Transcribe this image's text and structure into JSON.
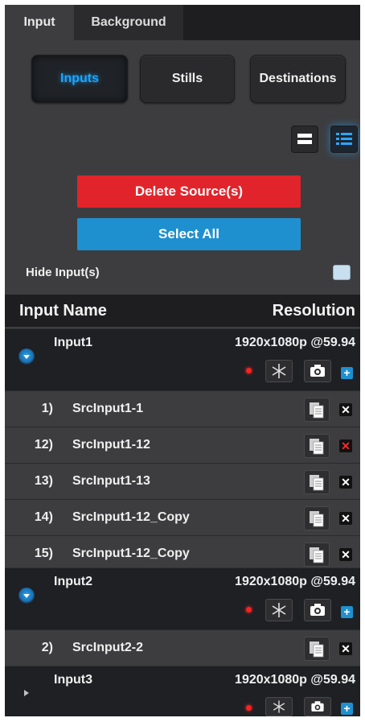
{
  "tabs": [
    {
      "label": "Input",
      "active": true
    },
    {
      "label": "Background",
      "active": false
    }
  ],
  "modes": {
    "inputs": "Inputs",
    "stills": "Stills",
    "destinations": "Destinations",
    "active": "inputs"
  },
  "view_toggle": {
    "single_icon": "single-view-icon",
    "list_icon": "list-view-icon",
    "active": "list"
  },
  "actions": {
    "delete_label": "Delete Source(s)",
    "select_all_label": "Select All"
  },
  "hide_inputs": {
    "label": "Hide Input(s)",
    "checked": false
  },
  "list_header": {
    "name": "Input Name",
    "resolution": "Resolution"
  },
  "groups": [
    {
      "name": "Input1",
      "resolution": "1920x1080p @59.94",
      "expanded": true,
      "sources": [
        {
          "num": "1)",
          "name": "SrcInput1-1",
          "delete_color": "white"
        },
        {
          "num": "12)",
          "name": "SrcInput1-12",
          "delete_color": "red"
        },
        {
          "num": "13)",
          "name": "SrcInput1-13",
          "delete_color": "white"
        },
        {
          "num": "14)",
          "name": "SrcInput1-12_Copy",
          "delete_color": "white"
        },
        {
          "num": "15)",
          "name": "SrcInput1-12_Copy",
          "delete_color": "white"
        }
      ]
    },
    {
      "name": "Input2",
      "resolution": "1920x1080p @59.94",
      "expanded": true,
      "sources": [
        {
          "num": "2)",
          "name": "SrcInput2-2",
          "delete_color": "white"
        }
      ]
    },
    {
      "name": "Input3",
      "resolution": "1920x1080p @59.94",
      "expanded": false,
      "sources": []
    }
  ],
  "colors": {
    "accent_blue": "#1f90cf",
    "delete_red": "#e1242b",
    "live_dot": "#ff2020"
  }
}
